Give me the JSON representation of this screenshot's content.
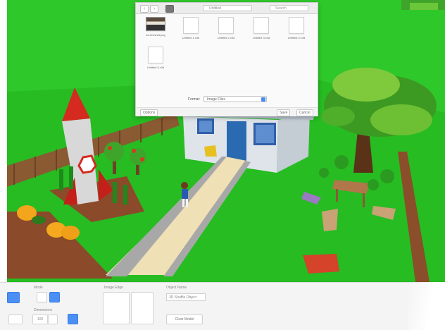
{
  "dialog": {
    "path_label": "Untitled",
    "search_placeholder": "Search",
    "files": [
      {
        "name": "screenshot.png",
        "kind": "image"
      },
      {
        "name": "Untitled 1.x3d",
        "kind": "doc"
      },
      {
        "name": "Untitled 2.x3d",
        "kind": "doc"
      },
      {
        "name": "Untitled 3.x3d",
        "kind": "doc"
      },
      {
        "name": "Untitled 4.x3d",
        "kind": "doc"
      },
      {
        "name": "Untitled 5.x3d",
        "kind": "doc"
      }
    ],
    "format_label": "Format:",
    "format_value": "Image Files",
    "footer_left_button": "Options",
    "footer_save_button": "Save",
    "footer_cancel_button": "Cancel"
  },
  "panel": {
    "mode_label": "Mode",
    "dimensions_label": "Dimensions",
    "dimension_value": "100",
    "image_label": "Image Edge",
    "object_name_label": "Object Name",
    "object_name_value": "3D Shuffle Object",
    "clear_button": "Clear Model"
  },
  "colors": {
    "accent": "#4c8ff4",
    "grass": "#22b81e",
    "sky_grass": "#2fc62a"
  }
}
